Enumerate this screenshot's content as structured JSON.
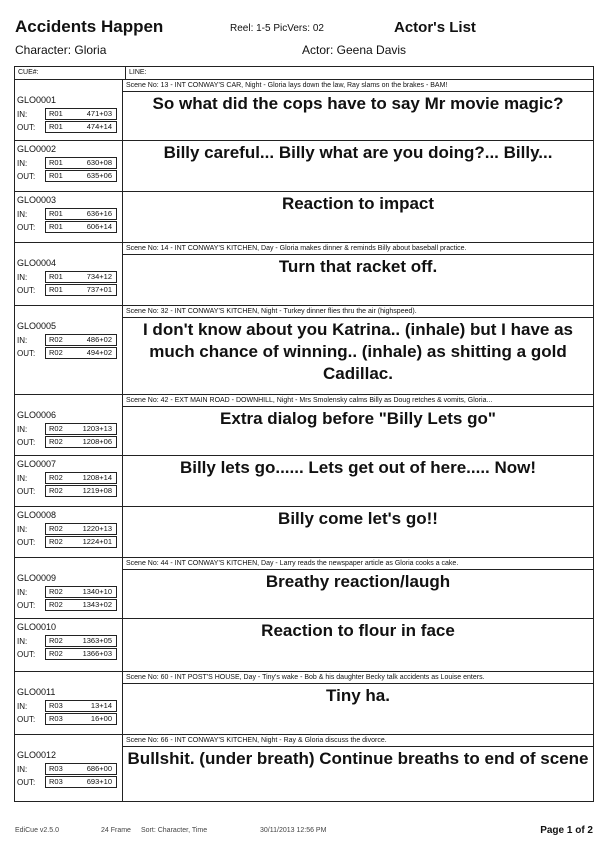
{
  "header": {
    "title": "Accidents Happen",
    "reel_info": "Reel: 1-5  PicVers: 02",
    "doc_type": "Actor's List",
    "character": "Character: Gloria",
    "actor": "Actor: Geena Davis"
  },
  "columns": {
    "cue": "CUE#:",
    "line": "LINE:"
  },
  "rows": [
    {
      "type": "scene",
      "text": "Scene No: 13 - INT CONWAY'S CAR, Night - Gloria lays down the law, Ray slams on the brakes - BAM!"
    },
    {
      "type": "cue",
      "id": "GLO0001",
      "in_reel": "R01",
      "in_time": "471+03",
      "out_reel": "R01",
      "out_time": "474+14",
      "line": "So what did the cops have to say Mr movie magic?"
    },
    {
      "type": "cue",
      "id": "GLO0002",
      "in_reel": "R01",
      "in_time": "630+08",
      "out_reel": "R01",
      "out_time": "635+06",
      "line": "Billy careful... Billy what are you doing?... Billy..."
    },
    {
      "type": "cue",
      "id": "GLO0003",
      "in_reel": "R01",
      "in_time": "636+16",
      "out_reel": "R01",
      "out_time": "606+14",
      "line": "Reaction to impact"
    },
    {
      "type": "scene",
      "text": "Scene No: 14 - INT CONWAY'S KITCHEN, Day - Gloria makes dinner & reminds Billy about baseball practice."
    },
    {
      "type": "cue",
      "id": "GLO0004",
      "in_reel": "R01",
      "in_time": "734+12",
      "out_reel": "R01",
      "out_time": "737+01",
      "line": "Turn that racket off."
    },
    {
      "type": "scene",
      "text": "Scene No: 32 - INT CONWAY'S KITCHEN, Night - Turkey dinner flies thru the air (highspeed)."
    },
    {
      "type": "cue",
      "id": "GLO0005",
      "in_reel": "R02",
      "in_time": "486+02",
      "out_reel": "R02",
      "out_time": "494+02",
      "line": "I don't know about you Katrina.. (inhale) but I have as much chance of winning.. (inhale) as shitting a gold Cadillac."
    },
    {
      "type": "scene",
      "text": "Scene No: 42 - EXT MAIN ROAD - DOWNHILL, Night - Mrs Smolensky calms Billy as Doug retches & vomits, Gloria..."
    },
    {
      "type": "cue",
      "id": "GLO0006",
      "in_reel": "R02",
      "in_time": "1203+13",
      "out_reel": "R02",
      "out_time": "1208+06",
      "line": "Extra dialog before \"Billy Lets go\""
    },
    {
      "type": "cue",
      "id": "GLO0007",
      "in_reel": "R02",
      "in_time": "1208+14",
      "out_reel": "R02",
      "out_time": "1219+08",
      "line": "Billy lets go...... Lets get out of here..... Now!"
    },
    {
      "type": "cue",
      "id": "GLO0008",
      "in_reel": "R02",
      "in_time": "1220+13",
      "out_reel": "R02",
      "out_time": "1224+01",
      "line": "Billy come let's go!!"
    },
    {
      "type": "scene",
      "text": "Scene No: 44 - INT CONWAY'S KITCHEN, Day - Larry reads the newspaper article as Gloria cooks a cake."
    },
    {
      "type": "cue",
      "id": "GLO0009",
      "in_reel": "R02",
      "in_time": "1340+10",
      "out_reel": "R02",
      "out_time": "1343+02",
      "line": "Breathy reaction/laugh"
    },
    {
      "type": "cue",
      "id": "GLO0010",
      "in_reel": "R02",
      "in_time": "1363+05",
      "out_reel": "R02",
      "out_time": "1366+03",
      "line": "Reaction to flour in face"
    },
    {
      "type": "scene",
      "text": "Scene No: 60 - INT POST'S HOUSE, Day - Tiny's wake - Bob & his daughter Becky talk accidents as Louise enters."
    },
    {
      "type": "cue",
      "id": "GLO0011",
      "in_reel": "R03",
      "in_time": "13+14",
      "out_reel": "R03",
      "out_time": "16+00",
      "line": "Tiny ha."
    },
    {
      "type": "scene",
      "text": "Scene No: 66 - INT CONWAY'S KITCHEN, Night - Ray & Gloria discuss the divorce."
    },
    {
      "type": "cue",
      "id": "GLO0012",
      "in_reel": "R03",
      "in_time": "686+00",
      "out_reel": "R03",
      "out_time": "693+10",
      "line": "Bullshit. (under breath) Continue breaths to end of scene"
    }
  ],
  "labels": {
    "in": "IN:",
    "out": "OUT:"
  },
  "footer": {
    "version": "EdiCue v2.5.0",
    "frame": "24 Frame",
    "sort": "Sort: Character, Time",
    "datetime": "30/11/2013  12:56 PM",
    "page": "Page 1 of 2"
  }
}
